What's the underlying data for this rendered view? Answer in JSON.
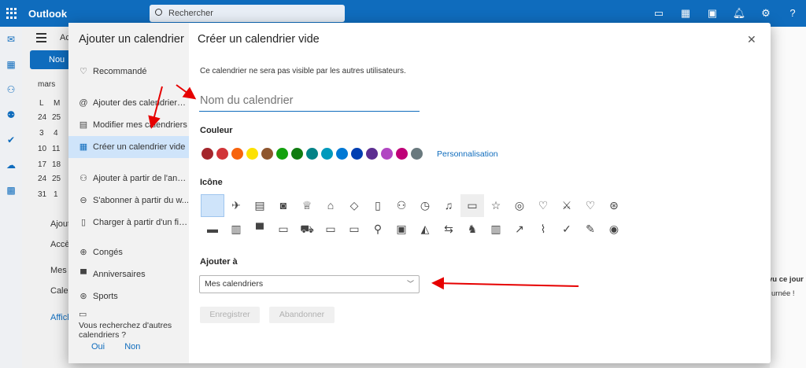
{
  "app": {
    "title": "Outlook",
    "search_placeholder": "Rechercher"
  },
  "background": {
    "new_button": "Nou",
    "month_label": "mars",
    "tab_partial": "Ac",
    "weekday_headers": [
      "L",
      "M"
    ],
    "date_rows": [
      [
        "24",
        "25"
      ],
      [
        "3",
        "4"
      ],
      [
        "10",
        "11"
      ],
      [
        "17",
        "18"
      ],
      [
        "24",
        "25"
      ],
      [
        "31",
        "1"
      ]
    ],
    "left_items": [
      "Ajout",
      "Accè",
      "Mes",
      "Caler",
      "Affich"
    ],
    "right_partial_1": "vu ce jour",
    "right_partial_2": "urnée !"
  },
  "dialog": {
    "side_title": "Ajouter un calendrier",
    "main_title": "Créer un calendrier vide",
    "close_label": "✕",
    "nav": [
      {
        "label": "Recommandé",
        "icon": "lightbulb-icon"
      },
      {
        "label": "Ajouter des calendriers ...",
        "icon": "at-icon"
      },
      {
        "label": "Modifier mes calendriers",
        "icon": "edit-calendar-icon"
      },
      {
        "label": "Créer un calendrier vide",
        "icon": "calendar-icon"
      },
      {
        "label": "Ajouter à partir de l'ann...",
        "icon": "people-icon"
      },
      {
        "label": "S'abonner à partir du w...",
        "icon": "globe-icon"
      },
      {
        "label": "Charger à partir d'un fic...",
        "icon": "file-icon"
      },
      {
        "label": "Congés",
        "icon": "globe-icon"
      },
      {
        "label": "Anniversaires",
        "icon": "cake-icon"
      },
      {
        "label": "Sports",
        "icon": "ball-icon"
      }
    ],
    "footer_question": "Vous recherchez d'autres calendriers ?",
    "footer_yes": "Oui",
    "footer_no": "Non",
    "subtitle": "Ce calendrier ne sera pas visible par les autres utilisateurs.",
    "name_placeholder": "Nom du calendrier",
    "color_label": "Couleur",
    "colors": [
      "#a4262c",
      "#d13438",
      "#f7630c",
      "#fce100",
      "#8e562e",
      "#13a10e",
      "#107c10",
      "#038387",
      "#0099bc",
      "#0078d4",
      "#003fb2",
      "#5c2e91",
      "#b146c2",
      "#bf0077",
      "#69797e"
    ],
    "personalisation": "Personnalisation",
    "icon_label": "Icône",
    "icon_rows": [
      [
        "calendar-blank",
        "airplane",
        "clipboard",
        "camera",
        "trophy",
        "home",
        "pill",
        "briefcase",
        "people",
        "timer",
        "music-note",
        "car",
        "star",
        "person",
        "heart-pulse",
        "fork-knife",
        "heart",
        "soccer-ball"
      ],
      [
        "movie-clapper",
        "book",
        "cake",
        "monitor",
        "truck",
        "ticket",
        "credit-card",
        "bicycle",
        "bus",
        "graduation-cap",
        "dumbbell",
        "horse",
        "building",
        "wrench",
        "sneaker",
        "checkmark",
        "note-edit",
        "target"
      ]
    ],
    "icon_glyphs": [
      [
        "",
        "✈",
        "▤",
        "◙",
        "♕",
        "⌂",
        "◇",
        "▯",
        "⚇",
        "◷",
        "♫",
        "▭",
        "☆",
        "◎",
        "♡",
        "⚔",
        "♡",
        "⊛"
      ],
      [
        "▬",
        "▥",
        "▀",
        "▭",
        "⛟",
        "▭",
        "▭",
        "⚲",
        "▣",
        "◭",
        "⇆",
        "♞",
        "▥",
        "↗",
        "⌇",
        "✓",
        "✎",
        "◉"
      ]
    ],
    "add_to_label": "Ajouter à",
    "add_to_value": "Mes calendriers",
    "save_button": "Enregistrer",
    "cancel_button": "Abandonner"
  },
  "annotation_color": "#e60000"
}
